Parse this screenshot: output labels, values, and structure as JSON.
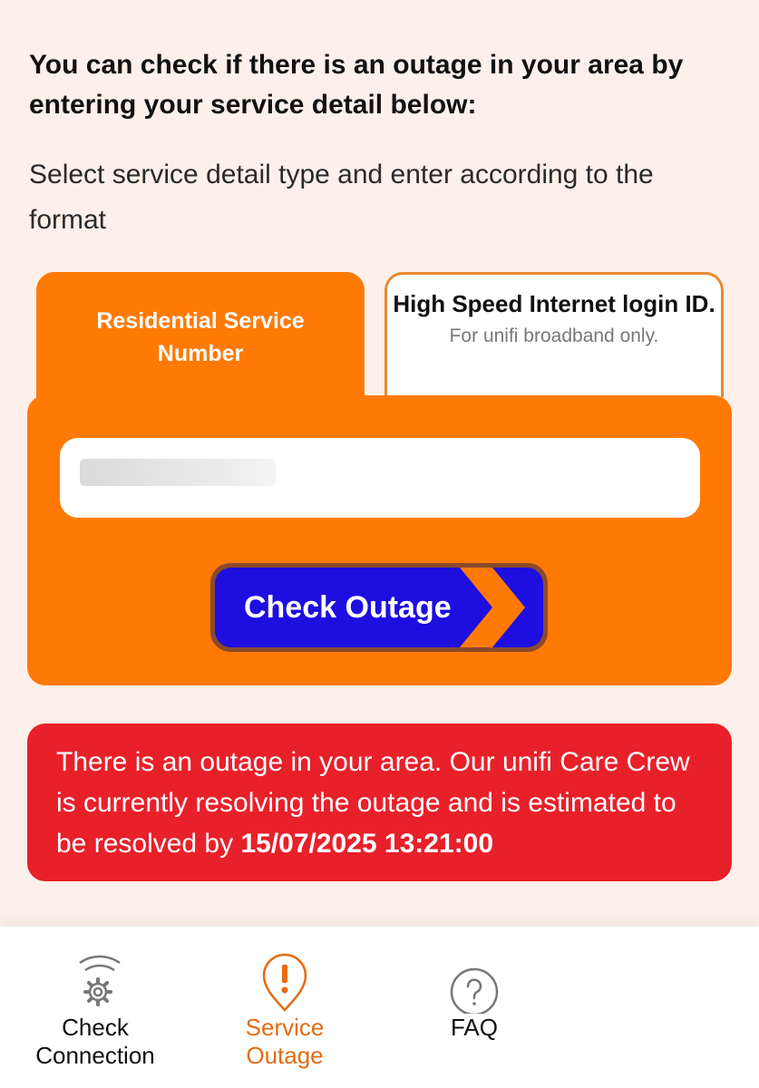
{
  "heading": "You can check if there is an outage in your area by entering your service detail below:",
  "subheading": "Select service detail type and enter according to the format",
  "tabs": {
    "residential": {
      "label": "Residential Service Number"
    },
    "high_speed": {
      "label": "High Speed Internet login ID.",
      "sublabel": "For unifi broadband only."
    }
  },
  "form": {
    "input_value": "",
    "check_button_label": "Check Outage"
  },
  "alert": {
    "message": "There is an outage in your area. Our unifi Care Crew is currently resolving the outage and is estimated to be resolved by ",
    "resolved_by": "15/07/2025 13:21:00"
  },
  "bottom_nav": {
    "check_connection": {
      "label_line1": "Check",
      "label_line2": "Connection",
      "icon": "wifi-gear-icon"
    },
    "service_outage": {
      "label_line1": "Service",
      "label_line2": "Outage",
      "icon": "alert-pin-icon"
    },
    "faq": {
      "label": "FAQ",
      "icon": "question-circle-icon"
    }
  },
  "colors": {
    "background": "#fdf0ea",
    "brand_orange": "#ff7a05",
    "button_blue": "#1e0ee0",
    "alert_red": "#e8202a",
    "active_nav": "#e56b12"
  }
}
